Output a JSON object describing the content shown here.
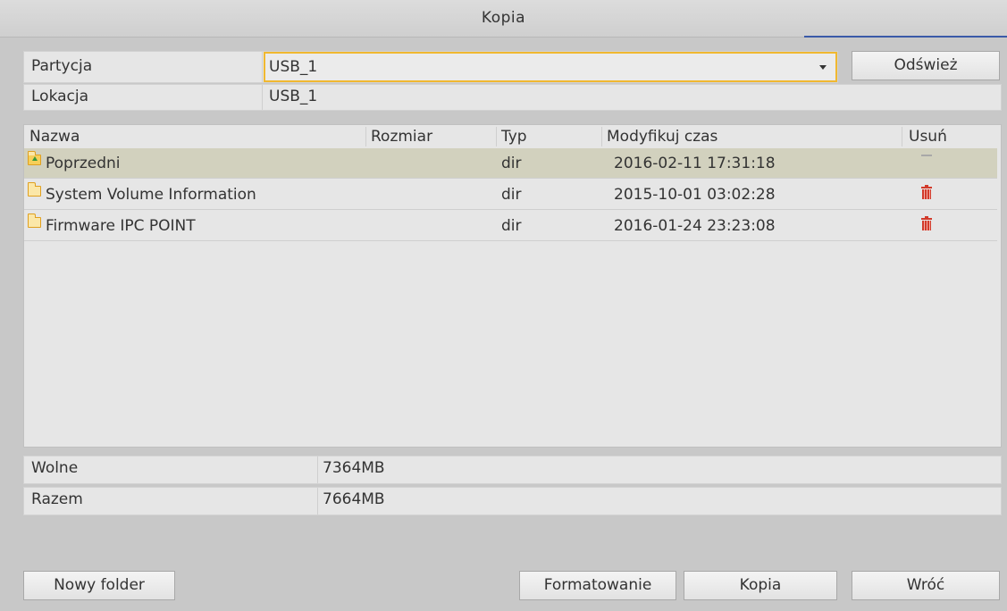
{
  "window": {
    "title": "Kopia"
  },
  "partition": {
    "label": "Partycja",
    "value": "USB_1"
  },
  "location": {
    "label": "Lokacja",
    "value": "USB_1"
  },
  "buttons": {
    "refresh": "Odśwież",
    "new_folder": "Nowy folder",
    "format": "Formatowanie",
    "copy": "Kopia",
    "back": "Wróć"
  },
  "table": {
    "columns": {
      "name": "Nazwa",
      "size": "Rozmiar",
      "type": "Typ",
      "modified": "Modyfikuj czas",
      "delete": "Usuń"
    },
    "rows": [
      {
        "name": "Poprzedni",
        "size": "",
        "type": "dir",
        "modified": "2016-02-11 17:31:18",
        "icon": "folder-up-icon",
        "action": "dash-icon"
      },
      {
        "name": "System Volume Information",
        "size": "",
        "type": "dir",
        "modified": "2015-10-01 03:02:28",
        "icon": "folder-icon",
        "action": "trash-icon"
      },
      {
        "name": "Firmware IPC POINT",
        "size": "",
        "type": "dir",
        "modified": "2016-01-24 23:23:08",
        "icon": "folder-icon",
        "action": "trash-icon"
      }
    ]
  },
  "free": {
    "label": "Wolne",
    "value": "7364MB"
  },
  "total": {
    "label": "Razem",
    "value": "7664MB"
  },
  "colors": {
    "accent_border": "#f0b830",
    "selected_row": "#d2d1be",
    "delete_red": "#d23a2a"
  }
}
